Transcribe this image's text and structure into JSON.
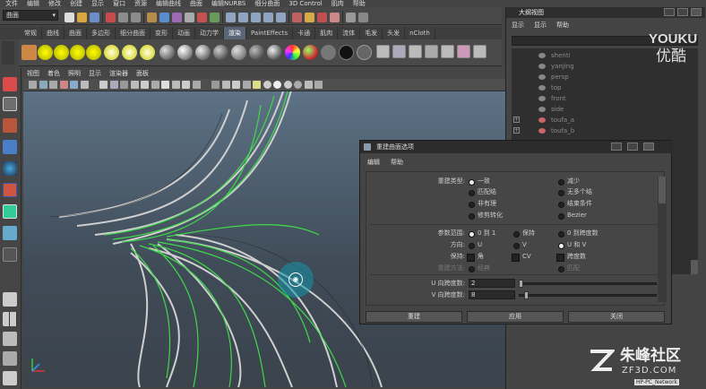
{
  "app": {
    "menubar": [
      "文件",
      "编辑",
      "修改",
      "创建",
      "显示",
      "窗口",
      "资源",
      "编辑曲线",
      "曲面",
      "编辑NURBS",
      "细分曲面",
      "3D Control",
      "肌肉",
      "帮助"
    ],
    "mode_selector": "曲面",
    "shelf_tabs": [
      "常规",
      "曲线",
      "曲面",
      "多边形",
      "细分曲面",
      "变形",
      "动画",
      "动力学",
      "渲染",
      "PaintEffects",
      "卡通",
      "肌肉",
      "流体",
      "毛发",
      "头发",
      "nCloth"
    ],
    "active_shelf_tab": "渲染",
    "viewport_menu": [
      "视图",
      "着色",
      "照明",
      "显示",
      "渲染器",
      "面板"
    ]
  },
  "outliner": {
    "title": "大纲视图",
    "menu": [
      "显示",
      "显示",
      "帮助"
    ],
    "items": [
      {
        "name": "shenti",
        "expand": ""
      },
      {
        "name": "yanjing",
        "expand": ""
      },
      {
        "name": "persp",
        "expand": ""
      },
      {
        "name": "top",
        "expand": ""
      },
      {
        "name": "front",
        "expand": ""
      },
      {
        "name": "side",
        "expand": ""
      },
      {
        "name": "toufa_a",
        "expand": "+"
      },
      {
        "name": "toufa_b",
        "expand": "+"
      }
    ]
  },
  "dialog": {
    "title": "重建曲面选项",
    "menu": [
      "编辑",
      "帮助"
    ],
    "rebuild_type": {
      "label": "重建类型:",
      "options": [
        "一致",
        "减少",
        "匹配结",
        "无多个结",
        "非有理",
        "结束条件",
        "修剪转化",
        "Bezier"
      ],
      "selected": "一致"
    },
    "param_range": {
      "label": "参数范围:",
      "options": [
        "0 到 1",
        "保持",
        "0 到跨度数"
      ],
      "selected": "0 到 1"
    },
    "direction": {
      "label": "方向:",
      "options": [
        "U",
        "V",
        "U 和 V"
      ],
      "selected": "U 和 V"
    },
    "keep": {
      "label": "保持:",
      "options": [
        "角",
        "CV",
        "跨度数"
      ]
    },
    "rebuild_method": {
      "label": "重建方法:",
      "options": [
        "经典",
        "匹配"
      ]
    },
    "u_spans": {
      "label": "U 向跨度数:",
      "value": "2"
    },
    "v_spans": {
      "label": "V 向跨度数:",
      "value": "8"
    },
    "buttons": {
      "rebuild": "重建",
      "apply": "应用",
      "close": "关闭"
    }
  },
  "watermarks": {
    "youku": "YOUKU",
    "youku_cn": "优酷",
    "site_cn": "朱峰社区",
    "site_url": "ZF3D.COM",
    "network": "HP-PC_Network"
  },
  "colors": {
    "active_tab": "#5a6678",
    "curve_green": "#3fd84a",
    "manip_cyan": "#1496aa",
    "viewport_top": "#5d7286"
  }
}
